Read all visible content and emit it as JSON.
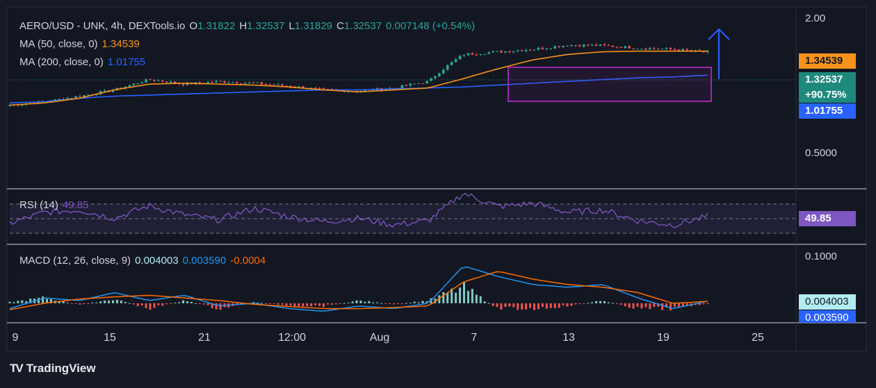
{
  "header": {
    "symbol": "AERO/USD - UNK, 4h, DEXTools.io",
    "o_label": "O",
    "o_value": "1.31822",
    "h_label": "H",
    "h_value": "1.32537",
    "l_label": "L",
    "l_value": "1.31829",
    "c_label": "C",
    "c_value": "1.32537",
    "change": "0.007148 (+0.54%)"
  },
  "ma50": {
    "label": "MA (50, close, 0)",
    "value": "1.34539"
  },
  "ma200": {
    "label": "MA (200, close, 0)",
    "value": "1.01755"
  },
  "rsi": {
    "label": "RSI (14)",
    "value": "49.85"
  },
  "macd": {
    "label": "MACD (12, 26, close, 9)",
    "macd_value": "0.004003",
    "signal_value": "0.003590",
    "hist_value": "-0.0004"
  },
  "price_axis": {
    "top": "2.00",
    "mid": "0.5000",
    "macd_top": "0.1000"
  },
  "price_tags": {
    "ma50": "1.34539",
    "last": "1.32537",
    "change_pct": "+90.75%",
    "ma200": "1.01755",
    "rsi": "49.85",
    "macd": "0.004003",
    "signal": "0.003590"
  },
  "time_axis": [
    "9",
    "15",
    "21",
    "12:00",
    "Aug",
    "7",
    "13",
    "19",
    "25"
  ],
  "brand": {
    "logo": "TV",
    "name": "TradingView"
  },
  "colors": {
    "background": "#161a25",
    "up": "#26a69a",
    "down": "#ef5350",
    "ma50": "#f7931a",
    "ma200": "#2962ff",
    "rsi": "#7e57c2",
    "macd_line": "#2196f3",
    "signal_line": "#ff6d00",
    "range_box": "#9c27b0",
    "arrow": "#2962ff"
  },
  "chart_data": [
    {
      "type": "candlestick",
      "title": "AERO/USD - UNK, 4h, DEXTools.io",
      "ylim": [
        0.3,
        2.0
      ],
      "x": [
        "9",
        "15",
        "21",
        "12:00",
        "Aug",
        "7",
        "13",
        "19",
        "25"
      ],
      "close_path": [
        0.72,
        0.75,
        0.8,
        0.86,
        0.97,
        0.92,
        0.95,
        0.93,
        0.9,
        0.86,
        0.85,
        0.88,
        0.95,
        1.3,
        1.34,
        1.38,
        1.45,
        1.44,
        1.4,
        1.38,
        1.33
      ],
      "series": [
        {
          "name": "MA (50, close, 0)",
          "values": [
            0.72,
            0.74,
            0.78,
            0.86,
            0.92,
            0.93,
            0.92,
            0.91,
            0.89,
            0.86,
            0.84,
            0.86,
            0.88,
            0.98,
            1.1,
            1.22,
            1.3,
            1.34,
            1.35,
            1.35,
            1.35
          ]
        },
        {
          "name": "MA (200, close, 0)",
          "values": [
            0.74,
            0.75,
            0.78,
            0.8,
            0.81,
            0.82,
            0.83,
            0.84,
            0.85,
            0.86,
            0.86,
            0.87,
            0.88,
            0.89,
            0.91,
            0.93,
            0.95,
            0.97,
            0.99,
            1.0,
            1.02
          ]
        }
      ]
    },
    {
      "type": "line",
      "title": "RSI (14)",
      "ylim": [
        20,
        80
      ],
      "values": [
        42,
        55,
        58,
        48,
        63,
        52,
        46,
        60,
        50,
        44,
        48,
        40,
        45,
        78,
        62,
        66,
        55,
        58,
        45,
        40,
        50
      ]
    },
    {
      "type": "line",
      "title": "MACD (12, 26, close, 9)",
      "ylim": [
        -0.03,
        0.1
      ],
      "series": [
        {
          "name": "MACD",
          "values": [
            -0.01,
            0.01,
            0.005,
            0.02,
            0.005,
            0.015,
            -0.005,
            0.0,
            -0.01,
            -0.015,
            -0.005,
            -0.01,
            0.0,
            0.07,
            0.05,
            0.035,
            0.03,
            0.035,
            0.01,
            -0.01,
            0.004
          ]
        },
        {
          "name": "Signal",
          "values": [
            -0.012,
            0.0,
            0.008,
            0.012,
            0.015,
            0.01,
            0.005,
            -0.002,
            -0.006,
            -0.01,
            -0.01,
            -0.008,
            -0.005,
            0.04,
            0.06,
            0.045,
            0.035,
            0.03,
            0.02,
            0.0,
            0.0036
          ]
        },
        {
          "name": "Histogram",
          "values": [
            0.002,
            0.01,
            -0.003,
            0.008,
            -0.01,
            0.005,
            -0.01,
            0.002,
            -0.004,
            -0.005,
            0.005,
            -0.002,
            0.005,
            0.03,
            -0.01,
            -0.01,
            -0.005,
            0.005,
            -0.01,
            -0.01,
            -0.0004
          ]
        }
      ]
    }
  ]
}
